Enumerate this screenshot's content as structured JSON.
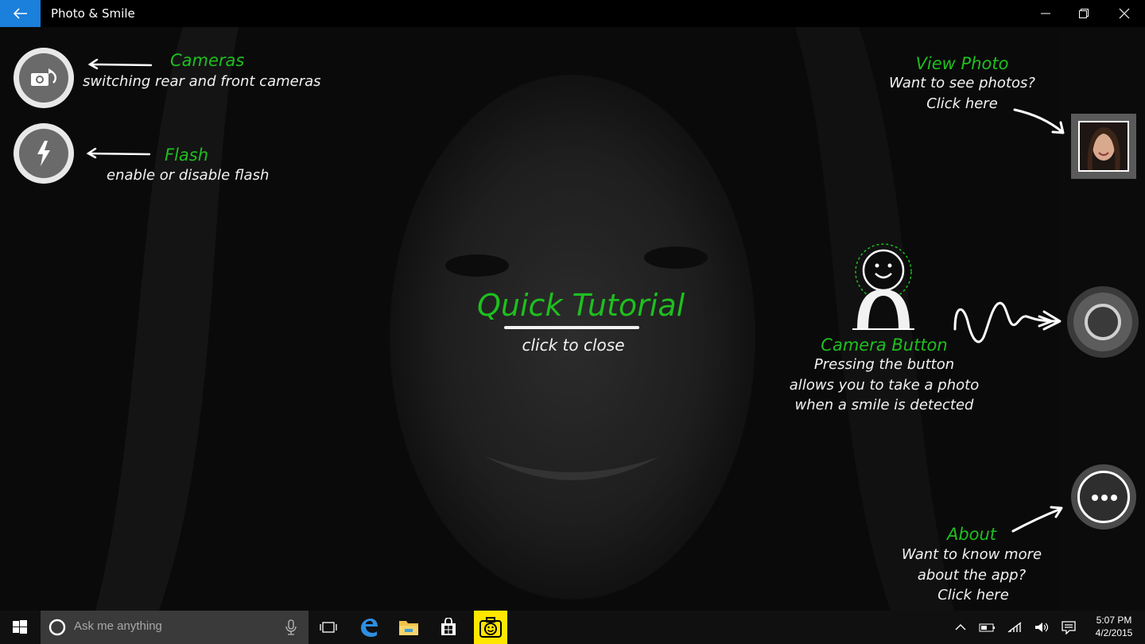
{
  "window": {
    "title": "Photo & Smile"
  },
  "tutorial": {
    "title": "Quick Tutorial",
    "subtitle": "click to close"
  },
  "cameras_tip": {
    "heading": "Cameras",
    "description": "switching  rear and  front cameras"
  },
  "flash_tip": {
    "heading": "Flash",
    "description": "enable or disable flash"
  },
  "view_photo_tip": {
    "heading": "View Photo",
    "line1": "Want to see photos?",
    "line2": "Click here"
  },
  "camera_button_tip": {
    "heading": "Camera Button",
    "line1": "Pressing the button",
    "line2": "allows you to take a photo",
    "line3": "when a smile is detected"
  },
  "about_tip": {
    "heading": "About",
    "line1": "Want to know more",
    "line2": "about the app?",
    "line3": "Click here"
  },
  "taskbar": {
    "search_placeholder": "Ask me anything",
    "time": "5:07 PM",
    "date": "4/2/2015",
    "icons": [
      "start-icon",
      "cortana-icon",
      "microphone-icon",
      "task-view-icon",
      "edge-icon",
      "file-explorer-icon",
      "store-icon",
      "photo-smile-app-icon",
      "show-hidden-icons-icon",
      "battery-icon",
      "wifi-icon",
      "volume-icon",
      "action-center-icon"
    ]
  },
  "colors": {
    "accent": "#1b7fdc",
    "tip_heading": "#1fbf1f",
    "app_icon_bg": "#ffe600"
  }
}
